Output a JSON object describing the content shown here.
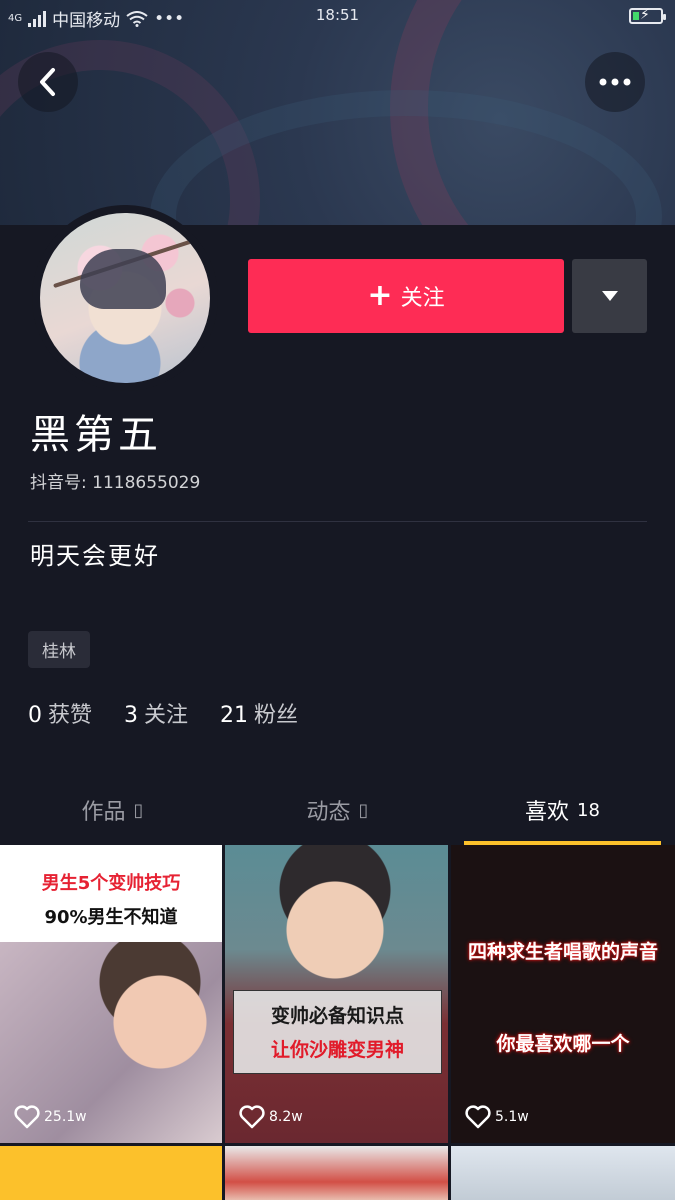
{
  "status_bar": {
    "network": "4G",
    "carrier": "中国移动",
    "more": "•••",
    "time": "18:51"
  },
  "profile": {
    "name": "黑第五",
    "douyin_id": "抖音号: 1118655029",
    "bio": "明天会更好",
    "location": "桂林",
    "follow_label": "关注",
    "follow_plus": "+",
    "stats": [
      {
        "num": "0",
        "label": "获赞"
      },
      {
        "num": "3",
        "label": "关注"
      },
      {
        "num": "21",
        "label": "粉丝"
      }
    ]
  },
  "tabs": [
    {
      "label": "作品",
      "count": "▯"
    },
    {
      "label": "动态",
      "count": "▯"
    },
    {
      "label": "喜欢",
      "count": "18"
    }
  ],
  "videos": [
    {
      "line1": "男生5个变帅技巧",
      "line2": "90%男生不知道",
      "likes": "25.1w"
    },
    {
      "line1": "变帅必备知识点",
      "line2": "让你沙雕变男神",
      "likes": "8.2w"
    },
    {
      "line1": "四种求生者唱歌的声音",
      "line2": "你最喜欢哪一个",
      "likes": "5.1w"
    }
  ],
  "colors": {
    "accent": "#fe2c55",
    "tab_indicator": "#fcc12b",
    "background": "#161823"
  },
  "icons": {
    "back": "chevron-left-icon",
    "more": "more-dots-icon",
    "dropdown": "triangle-down-icon",
    "like": "heart-outline-icon"
  }
}
